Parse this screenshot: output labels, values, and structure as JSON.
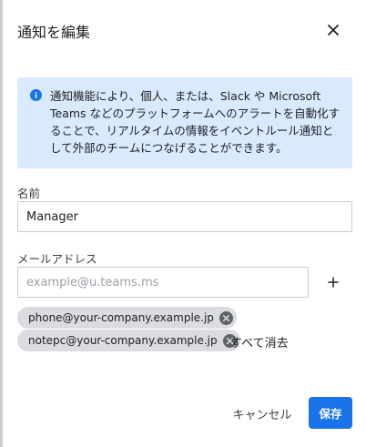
{
  "dialog": {
    "title": "通知を編集",
    "close_icon": "close-icon"
  },
  "info": {
    "icon": "info-icon",
    "text": "通知機能により、個人、または、Slack や Microsoft Teams などのプラットフォームへのアラートを自動化することで、リアルタイムの情報をイベントルール通知として外部のチームにつなげることができます。"
  },
  "form": {
    "name_label": "名前",
    "name_value": "Manager",
    "email_label": "メールアドレス",
    "email_placeholder": "example@u.teams.ms",
    "add_icon": "plus-icon",
    "emails": [
      "phone@your-company.example.jp",
      "notepc@your-company.example.jp"
    ],
    "clear_all_label": "すべて消去"
  },
  "footer": {
    "cancel_label": "キャンセル",
    "save_label": "保存"
  },
  "colors": {
    "accent": "#1a73e8",
    "info_bg": "#d9eafe",
    "chip_bg": "#dadce0"
  }
}
